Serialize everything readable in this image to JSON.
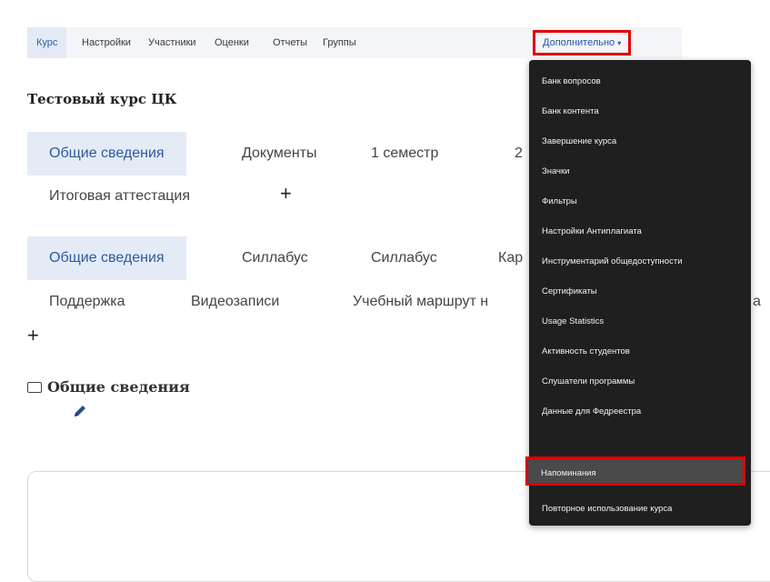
{
  "topnav": {
    "tabs": [
      "Курс",
      "Настройки",
      "Участники",
      "Оценки",
      "Отчеты",
      "Группы"
    ],
    "more_label": "Дополнительно",
    "more_caret": "▾"
  },
  "course": {
    "title": "Тестовый курс ЦК"
  },
  "section_tabs_1": [
    "Общие сведения",
    "Документы",
    "1 семестр",
    "2"
  ],
  "section_tabs_1b": [
    "Итоговая аттестация"
  ],
  "section_tabs_2": [
    "Общие сведения",
    "Силлабус",
    "Силлабус",
    "Кар"
  ],
  "section_tabs_2b": [
    "Поддержка",
    "Видеозаписи",
    "Учебный маршрут н",
    "а"
  ],
  "plus_label": "+",
  "section": {
    "title": "Общие сведения",
    "edit_icon": "pencil-icon"
  },
  "dropdown": {
    "items": [
      "Банк вопросов",
      "Банк контента",
      "Завершение курса",
      "Значки",
      "Фильтры",
      "Настройки Антиплагиата",
      "Инструментарий общедоступности",
      "Сертификаты",
      "Usage Statistics",
      "Активность студентов",
      "Слушатели программы",
      "Данные для Федреестра",
      "Напоминания",
      "Повторное использование курса"
    ],
    "highlighted_index": 12
  },
  "colors": {
    "highlight_border": "#e00000",
    "accent": "#2c5aa0",
    "menu_bg": "#1f1f1f"
  }
}
